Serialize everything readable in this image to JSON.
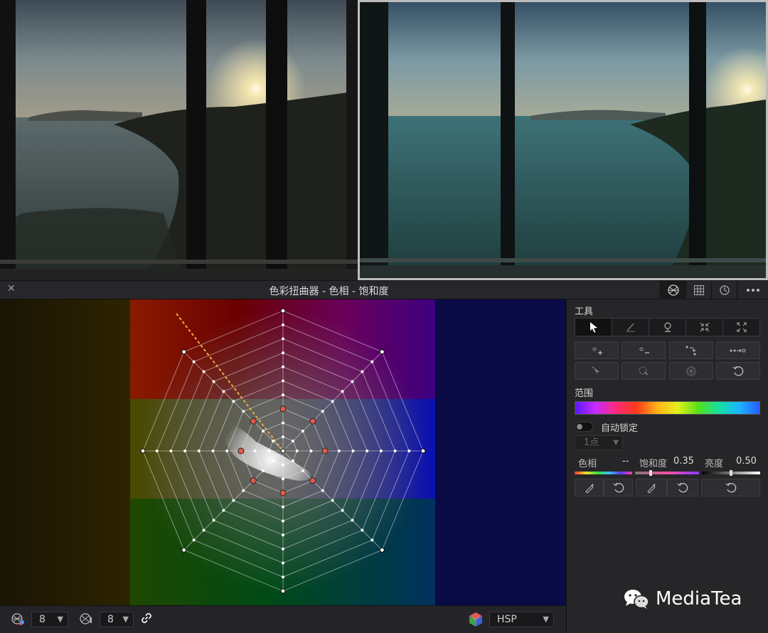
{
  "panel": {
    "title": "色彩扭曲器 - 色相 - 饱和度",
    "close_label": "✕"
  },
  "bottom_bar": {
    "hue_points_value": "8",
    "sat_points_value": "8",
    "color_space": "HSP"
  },
  "tools": {
    "heading": "工具",
    "range_heading": "范围",
    "auto_lock_label": "自动锁定",
    "point_count": "1点",
    "hue_label": "色相",
    "hue_value": "--",
    "saturation_label": "饱和度",
    "saturation_value": "0.35",
    "luminance_label": "亮度",
    "luminance_value": "0.50"
  },
  "watermark": {
    "text": "MediaTea"
  },
  "icons": {
    "header": [
      "color-warper-icon",
      "grid-icon",
      "history-icon",
      "more-options-icon"
    ],
    "tool_modes": [
      "pointer-icon",
      "brush-icon",
      "pin-icon",
      "collapse-icon",
      "expand-icon"
    ],
    "tool_actions": [
      "add-point-icon",
      "remove-point-icon",
      "swap-icon",
      "link-points-icon",
      "select-icon",
      "lasso-icon",
      "center-icon",
      "reset-icon"
    ]
  },
  "colors": {
    "accent_point": "#e05a4a",
    "guide_line": "#e8b040",
    "panel_bg": "#262629"
  }
}
